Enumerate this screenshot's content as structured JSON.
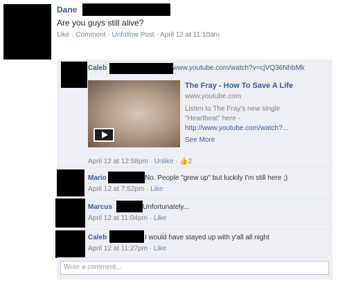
{
  "post": {
    "author": "Dane",
    "text": "Are you guys still alive?",
    "actions": {
      "like": "Like",
      "comment": "Comment",
      "unfollow": "Unfollow Post",
      "timestamp": "April 12 at 11:10am"
    }
  },
  "shared_link": {
    "author": "Caleb",
    "url_text": "www.youtube.com/watch?v=cjVQ36NhbMk",
    "title": "The Fray - How To Save A Life",
    "domain": "www.youtube.com",
    "description_line1": "Listen to The Fray's new single",
    "description_line2": "\"Heartbeat\" here -",
    "description_line3": "http://www.youtube.com/watch?...",
    "see_more": "See More",
    "timestamp": "April 12 at 12:58pm",
    "unlike": "Unlike",
    "like_count": "2"
  },
  "comments": [
    {
      "author": "Mario",
      "text": "No. People \"grew up\" but luckily I'm still here ;)",
      "timestamp": "April 12 at 7:52pm",
      "like": "Like"
    },
    {
      "author": "Marcus",
      "text": "Unfortunately...",
      "timestamp": "April 12 at 11:04pm",
      "like": "Like"
    },
    {
      "author": "Caleb",
      "text": "I would have stayed up with y'all all night",
      "timestamp": "April 12 at 11:27pm",
      "like": "Like"
    }
  ],
  "comment_box": {
    "placeholder": "Write a comment..."
  },
  "icons": {
    "play": "play-icon",
    "thumbs_up": "thumbs-up-icon"
  },
  "colors": {
    "link": "#3b5998",
    "panel": "#edeff4",
    "meta": "#808080"
  }
}
